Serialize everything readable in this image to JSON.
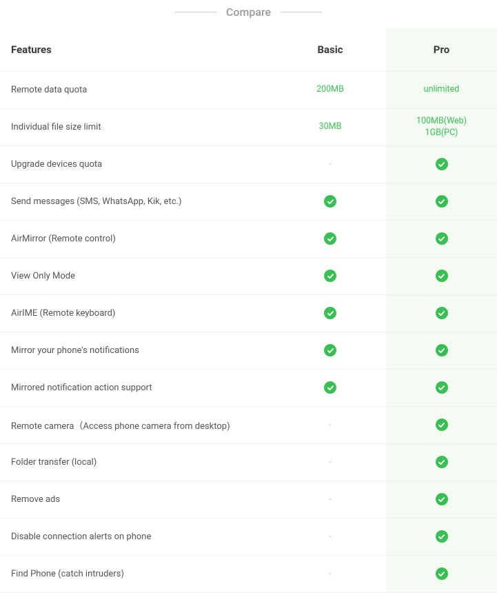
{
  "title": "Compare",
  "columns": {
    "feature": "Features",
    "basic": "Basic",
    "pro": "Pro"
  },
  "rows": [
    {
      "feature": "Remote data quota",
      "basic": {
        "type": "text",
        "value": "200MB"
      },
      "pro": {
        "type": "text",
        "value": "unlimited"
      }
    },
    {
      "feature": "Individual file size limit",
      "basic": {
        "type": "text",
        "value": "30MB"
      },
      "pro": {
        "type": "text",
        "value": "100MB(Web)\n1GB(PC)"
      }
    },
    {
      "feature": "Upgrade devices quota",
      "basic": {
        "type": "dash"
      },
      "pro": {
        "type": "check"
      }
    },
    {
      "feature": "Send messages (SMS, WhatsApp, Kik, etc.)",
      "basic": {
        "type": "check"
      },
      "pro": {
        "type": "check"
      }
    },
    {
      "feature": "AirMirror (Remote control)",
      "basic": {
        "type": "check"
      },
      "pro": {
        "type": "check"
      }
    },
    {
      "feature": "View Only Mode",
      "basic": {
        "type": "check"
      },
      "pro": {
        "type": "check"
      }
    },
    {
      "feature": "AirIME (Remote keyboard)",
      "basic": {
        "type": "check"
      },
      "pro": {
        "type": "check"
      }
    },
    {
      "feature": "Mirror your phone's notifications",
      "basic": {
        "type": "check"
      },
      "pro": {
        "type": "check"
      }
    },
    {
      "feature": "Mirrored notification action support",
      "basic": {
        "type": "check"
      },
      "pro": {
        "type": "check"
      }
    },
    {
      "feature": "Remote camera（Access phone camera from desktop)",
      "basic": {
        "type": "dash"
      },
      "pro": {
        "type": "check"
      }
    },
    {
      "feature": "Folder transfer (local)",
      "basic": {
        "type": "dash"
      },
      "pro": {
        "type": "check"
      }
    },
    {
      "feature": "Remove ads",
      "basic": {
        "type": "dash"
      },
      "pro": {
        "type": "check"
      }
    },
    {
      "feature": "Disable connection alerts on phone",
      "basic": {
        "type": "dash"
      },
      "pro": {
        "type": "check"
      }
    },
    {
      "feature": "Find Phone (catch intruders)",
      "basic": {
        "type": "dash"
      },
      "pro": {
        "type": "check"
      }
    }
  ]
}
